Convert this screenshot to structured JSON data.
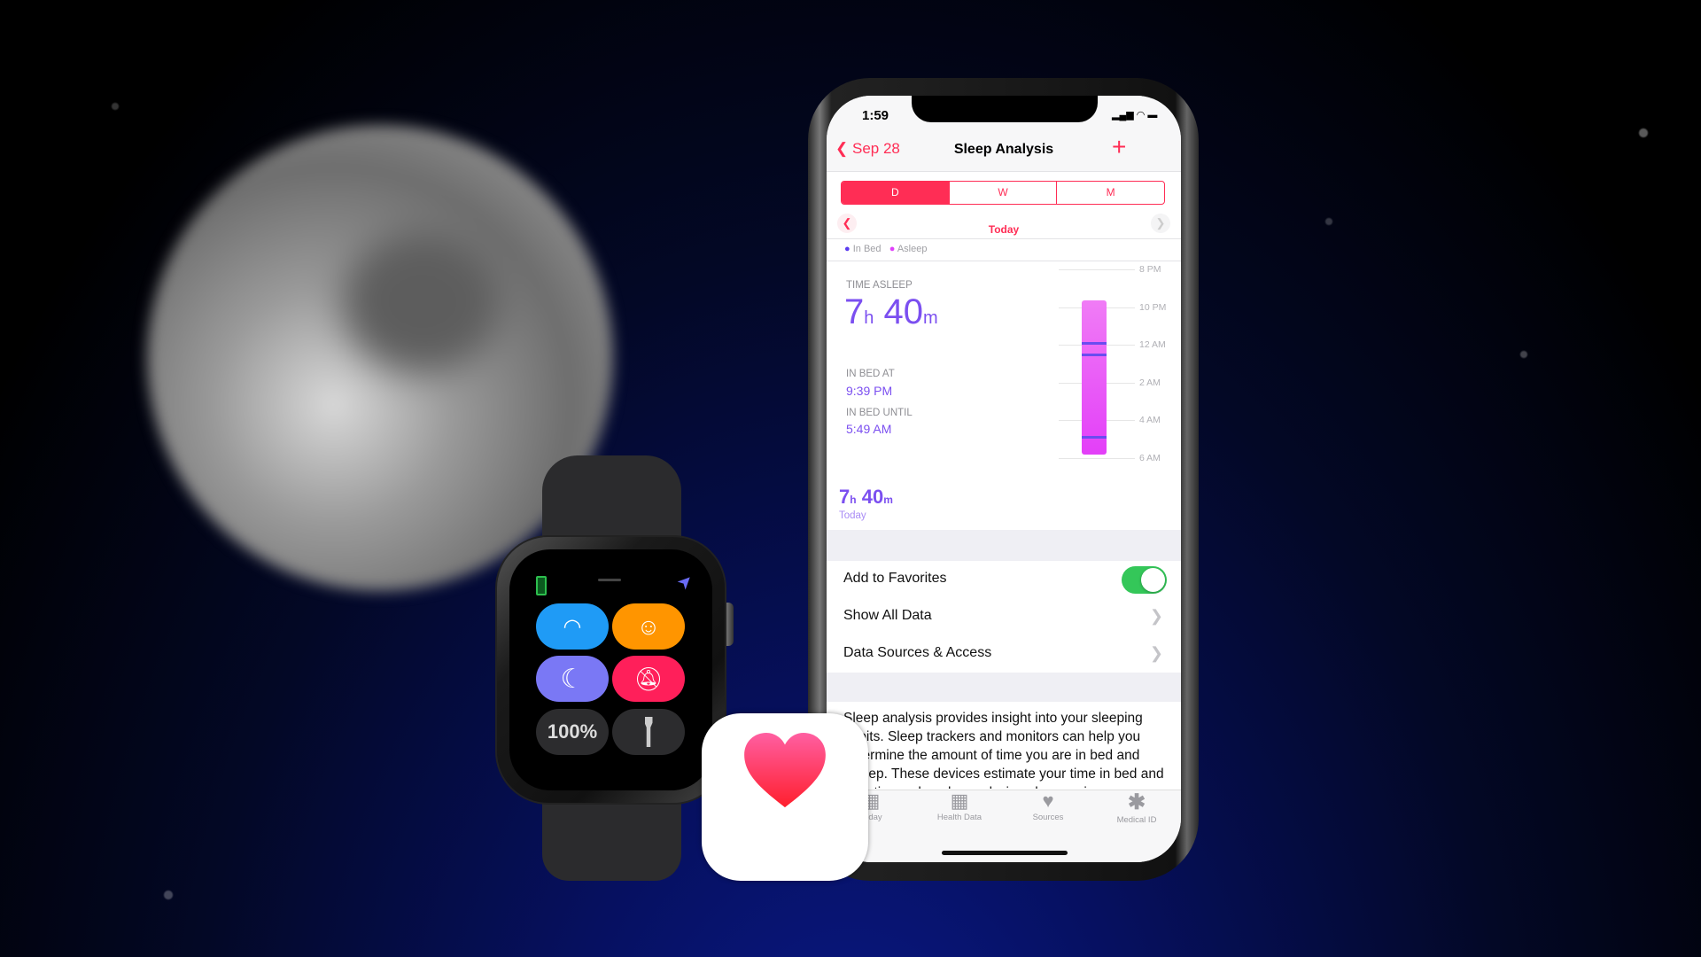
{
  "status_bar": {
    "time": "1:59"
  },
  "nav": {
    "back_label": "Sep 28",
    "title": "Sleep Analysis",
    "add_icon": "plus-icon"
  },
  "segments": [
    "D",
    "W",
    "M"
  ],
  "selected_segment": "D",
  "period_label": "Today",
  "legend": [
    {
      "label": "In Bed",
      "color": "#5b3cf0"
    },
    {
      "label": "Asleep",
      "color": "#e040fb"
    }
  ],
  "summary": {
    "label": "TIME ASLEEP",
    "hours": "7",
    "h_unit": "h",
    "minutes": "40",
    "m_unit": "m",
    "in_bed_at_label": "IN BED AT",
    "in_bed_at": "9:39 PM",
    "in_bed_until_label": "IN BED UNTIL",
    "in_bed_until": "5:49 AM",
    "total_hours": "7",
    "total_minutes": "40",
    "total_label": "Today"
  },
  "chart_data": {
    "type": "bar",
    "orientation": "vertical-time",
    "ticks": [
      "8 PM",
      "10 PM",
      "12 AM",
      "2 AM",
      "4 AM",
      "6 AM"
    ],
    "in_bed": {
      "start": "9:39 PM",
      "end": "5:49 AM"
    },
    "in_bed_marks": [
      "11:54 PM",
      "12:30 AM",
      "4:52 AM"
    ]
  },
  "rows": [
    {
      "label": "Add to Favorites",
      "toggle": true
    },
    {
      "label": "Show All Data"
    },
    {
      "label": "Data Sources & Access"
    }
  ],
  "description": "Sleep analysis provides insight into your sleeping habits. Sleep trackers and monitors can help you determine the amount of time you are in bed and asleep. These devices estimate your time in bed and your time asleep by analyzing changes in",
  "tabs": [
    {
      "label": "Today",
      "icon": "today-icon"
    },
    {
      "label": "Health Data",
      "icon": "grid-icon"
    },
    {
      "label": "Sources",
      "icon": "heart-download-icon"
    },
    {
      "label": "Medical ID",
      "icon": "asterisk-icon"
    }
  ],
  "watch": {
    "buttons": [
      {
        "icon": "wifi-icon",
        "color": "#1f9bf6"
      },
      {
        "icon": "theater-mode-icon",
        "color": "#ff9500"
      },
      {
        "icon": "moon-icon",
        "color": "#7a78f5"
      },
      {
        "icon": "silent-bell-icon",
        "color": "#ff1f5a"
      },
      {
        "label": "100%",
        "color": "#2c2c2e"
      },
      {
        "icon": "flashlight-icon",
        "color": "#2c2c2e"
      }
    ]
  },
  "colors": {
    "accent": "#ff2d55",
    "sleep_purple": "#7b4ff0",
    "toggle_on": "#34c759"
  }
}
